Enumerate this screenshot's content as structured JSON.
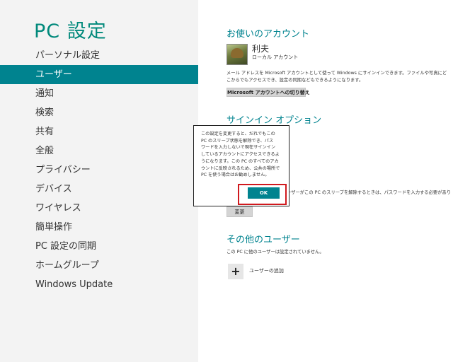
{
  "left": {
    "title": "PC 設定",
    "nav": [
      {
        "label": "パーソナル設定",
        "selected": false
      },
      {
        "label": "ユーザー",
        "selected": true
      },
      {
        "label": "通知",
        "selected": false
      },
      {
        "label": "検索",
        "selected": false
      },
      {
        "label": "共有",
        "selected": false
      },
      {
        "label": "全般",
        "selected": false
      },
      {
        "label": "プライバシー",
        "selected": false
      },
      {
        "label": "デバイス",
        "selected": false
      },
      {
        "label": "ワイヤレス",
        "selected": false
      },
      {
        "label": "簡単操作",
        "selected": false
      },
      {
        "label": "PC 設定の同期",
        "selected": false
      },
      {
        "label": "ホームグループ",
        "selected": false
      },
      {
        "label": "Windows Update",
        "selected": false
      }
    ]
  },
  "account": {
    "title": "お使いのアカウント",
    "name": "利夫",
    "type": "ローカル アカウント",
    "desc_line1": "メール アドレスを Microsoft アカウントとして使って Windows にサインインできます。ファイルや写真にど",
    "desc_line2": "こからでもアクセスでき、設定の同期などもできるようになります。",
    "switch_button": "Microsoft アカウントへの切り替え"
  },
  "signin": {
    "title": "サインイン オプション",
    "partial_text": "ーザーがこの PC のスリープを解除するときは、パスワードを入力する必要があり",
    "change_button": "変更"
  },
  "dialog": {
    "lines": [
      "この設定を変更すると、だれでもこの",
      "PC のスリープ状態を解除でき、パス",
      "ワードを入力しないで現在サインイン",
      "しているアカウントにアクセスできるよ",
      "うになります。この PC のすべてのアカ",
      "ウントに反映されるため、公共の場所で",
      "PC を使う場合はお勧めしません。"
    ],
    "ok_label": "OK"
  },
  "other_users": {
    "title": "その他のユーザー",
    "desc": "この PC に他のユーザーは設定されていません。",
    "add_icon": "+",
    "add_label": "ユーザーの追加"
  }
}
